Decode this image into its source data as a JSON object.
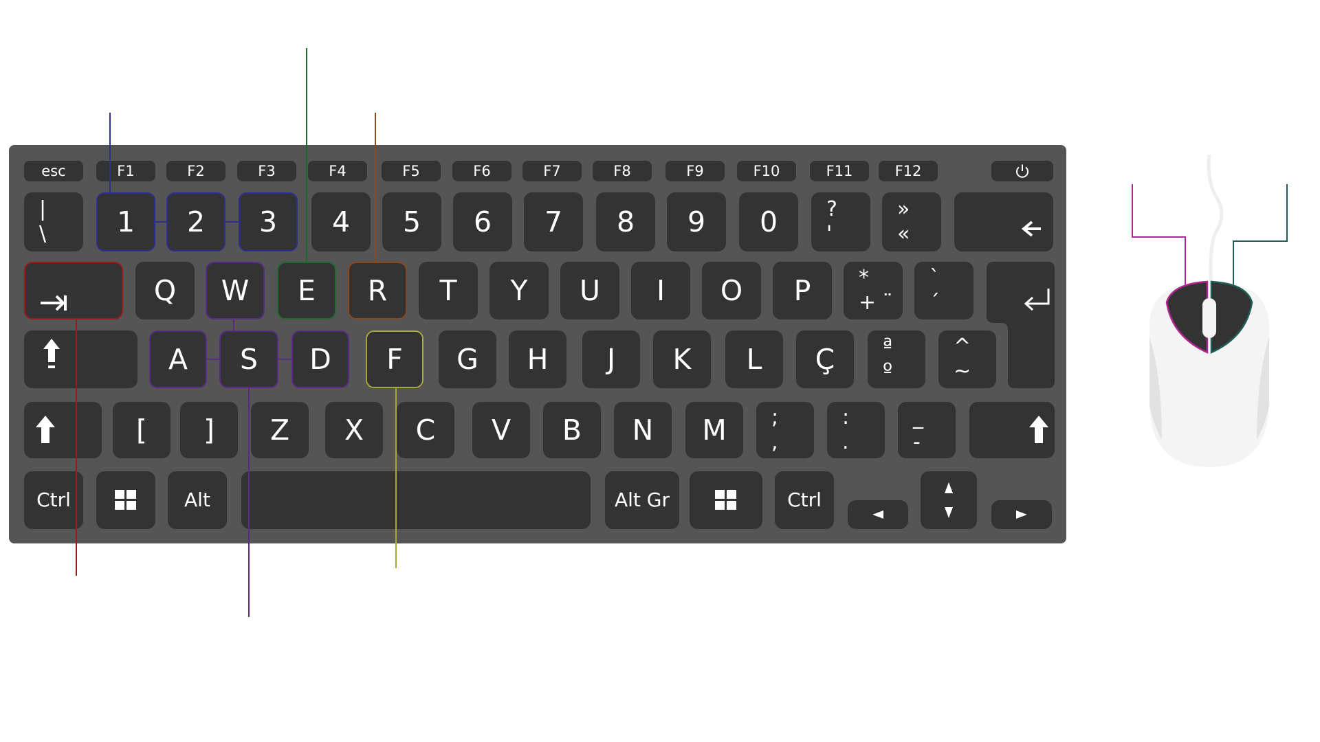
{
  "keyboard": {
    "function_row": [
      "esc",
      "F1",
      "F2",
      "F3",
      "F4",
      "F5",
      "F6",
      "F7",
      "F8",
      "F9",
      "F10",
      "F11",
      "F12"
    ],
    "number_row": [
      "1",
      "2",
      "3",
      "4",
      "5",
      "6",
      "7",
      "8",
      "9",
      "0"
    ],
    "number_row_extra": [
      {
        "top": "?",
        "bot": "'"
      },
      {
        "top": "»",
        "bot": "«"
      }
    ],
    "backslash_key": {
      "top": "|",
      "bot": "\\"
    },
    "qwerty_row": [
      "Q",
      "W",
      "E",
      "R",
      "T",
      "Y",
      "U",
      "I",
      "O",
      "P"
    ],
    "qwerty_row_extra": [
      {
        "top": "*",
        "bot": "+  ¨"
      },
      {
        "top": "`",
        "bot": "´"
      }
    ],
    "home_row": [
      "A",
      "S",
      "D",
      "F",
      "G",
      "H",
      "J",
      "K",
      "L",
      "Ç"
    ],
    "home_row_extra": [
      {
        "top": "ª",
        "bot": "º"
      },
      {
        "top": "^",
        "bot": "~"
      }
    ],
    "bottom_letter_row": [
      "[",
      "]",
      "Z",
      "X",
      "C",
      "V",
      "B",
      "N",
      "M"
    ],
    "bottom_letter_row_extra": [
      {
        "top": ";",
        "bot": ","
      },
      {
        "top": ":",
        "bot": "."
      },
      {
        "top": "_",
        "bot": "-"
      }
    ],
    "modifiers": {
      "ctrl_left": "Ctrl",
      "alt": "Alt",
      "alt_gr": "Alt Gr",
      "ctrl_right": "Ctrl"
    },
    "icons": {
      "power": "power-icon",
      "backspace": "left-arrow-icon",
      "tab": "tab-icon",
      "enter": "enter-icon",
      "caps": "caps-lock-icon",
      "shift": "shift-arrow-icon",
      "windows": "windows-icon",
      "arrows": [
        "left-arrow-icon",
        "up-arrow-icon",
        "down-arrow-icon",
        "right-arrow-icon"
      ]
    }
  },
  "highlight_colors": {
    "numbers_1_2_3": "#2b2f8f",
    "key_e": "#1f6b2e",
    "key_r": "#8a4a1e",
    "key_tab": "#9b1b1b",
    "keys_w_a_s_d": "#5b2a86",
    "key_f": "#a8a83a",
    "mouse_left_button": "#b0258f",
    "mouse_right_button": "#1f5e56"
  }
}
